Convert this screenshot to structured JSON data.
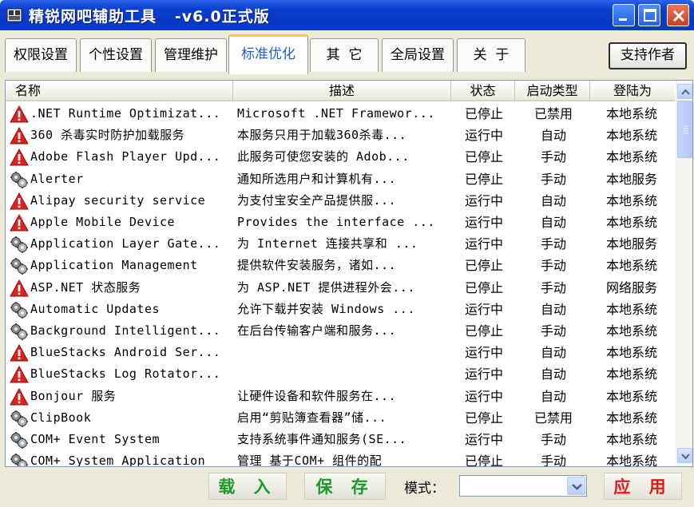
{
  "window": {
    "title": "精锐网吧辅助工具   -v6.0正式版"
  },
  "tabs": [
    {
      "label": "权限设置",
      "active": false
    },
    {
      "label": "个性设置",
      "active": false
    },
    {
      "label": "管理维护",
      "active": false
    },
    {
      "label": "标准优化",
      "active": true
    },
    {
      "label": "其  它",
      "active": false
    },
    {
      "label": "全局设置",
      "active": false
    },
    {
      "label": "关  于",
      "active": false
    }
  ],
  "support_button": "支持作者",
  "table": {
    "columns": [
      "名称",
      "描述",
      "状态",
      "启动类型",
      "登陆为"
    ],
    "rows": [
      {
        "icon": "warning-icon",
        "name": ".NET Runtime Optimizat...",
        "desc": "Microsoft .NET Framewor...",
        "status": "已停止",
        "start": "已禁用",
        "logon": "本地系统"
      },
      {
        "icon": "warning-icon",
        "name": "360 杀毒实时防护加载服务",
        "desc": "本服务只用于加载360杀毒...",
        "status": "运行中",
        "start": "自动",
        "logon": "本地系统"
      },
      {
        "icon": "warning-icon",
        "name": "Adobe Flash Player Upd...",
        "desc": "此服务可使您安装的 Adob...",
        "status": "已停止",
        "start": "手动",
        "logon": "本地系统"
      },
      {
        "icon": "gears-icon",
        "name": "Alerter",
        "desc": "通知所选用户和计算机有...",
        "status": "已停止",
        "start": "手动",
        "logon": "本地服务"
      },
      {
        "icon": "warning-icon",
        "name": "Alipay security service",
        "desc": "为支付宝安全产品提供服...",
        "status": "运行中",
        "start": "自动",
        "logon": "本地系统"
      },
      {
        "icon": "warning-icon",
        "name": "Apple Mobile Device",
        "desc": "Provides the interface ...",
        "status": "运行中",
        "start": "自动",
        "logon": "本地系统"
      },
      {
        "icon": "gears-icon",
        "name": "Application Layer Gate...",
        "desc": "为 Internet 连接共享和 ...",
        "status": "运行中",
        "start": "手动",
        "logon": "本地服务"
      },
      {
        "icon": "gears-icon",
        "name": "Application Management",
        "desc": "提供软件安装服务，诸如...",
        "status": "已停止",
        "start": "手动",
        "logon": "本地系统"
      },
      {
        "icon": "warning-icon",
        "name": "ASP.NET 状态服务",
        "desc": "为 ASP.NET 提供进程外会...",
        "status": "已停止",
        "start": "手动",
        "logon": "网络服务"
      },
      {
        "icon": "gears-icon",
        "name": "Automatic Updates",
        "desc": "允许下载并安装 Windows ...",
        "status": "运行中",
        "start": "自动",
        "logon": "本地系统"
      },
      {
        "icon": "gears-icon",
        "name": "Background Intelligent...",
        "desc": "在后台传输客户端和服务...",
        "status": "已停止",
        "start": "手动",
        "logon": "本地系统"
      },
      {
        "icon": "warning-icon",
        "name": "BlueStacks Android Ser...",
        "desc": "",
        "status": "运行中",
        "start": "自动",
        "logon": "本地系统"
      },
      {
        "icon": "warning-icon",
        "name": "BlueStacks Log Rotator...",
        "desc": "",
        "status": "运行中",
        "start": "自动",
        "logon": "本地系统"
      },
      {
        "icon": "warning-icon",
        "name": "Bonjour 服务",
        "desc": "让硬件设备和软件服务在...",
        "status": "运行中",
        "start": "自动",
        "logon": "本地系统"
      },
      {
        "icon": "gears-icon",
        "name": "ClipBook",
        "desc": "启用“剪贴簿查看器”储...",
        "status": "已停止",
        "start": "已禁用",
        "logon": "本地系统"
      },
      {
        "icon": "gears-icon",
        "name": "COM+ Event System",
        "desc": "支持系统事件通知服务(SE...",
        "status": "运行中",
        "start": "手动",
        "logon": "本地系统"
      },
      {
        "icon": "gears-icon",
        "name": "COM+ System Application",
        "desc": "管理 基于COM+ 组件的配",
        "status": "已停止",
        "start": "手动",
        "logon": "本地系统"
      }
    ]
  },
  "bottom": {
    "load_label": "载 入",
    "save_label": "保 存",
    "mode_label": "模式：",
    "mode_value": "",
    "apply_label": "应 用"
  },
  "colors": {
    "titlebar": "#0a3fd0",
    "active_tab_text": "#1f5ccf",
    "green_button_text": "#1a9a29",
    "red_button_text": "#e21818",
    "warning_icon": "#d8231f"
  }
}
